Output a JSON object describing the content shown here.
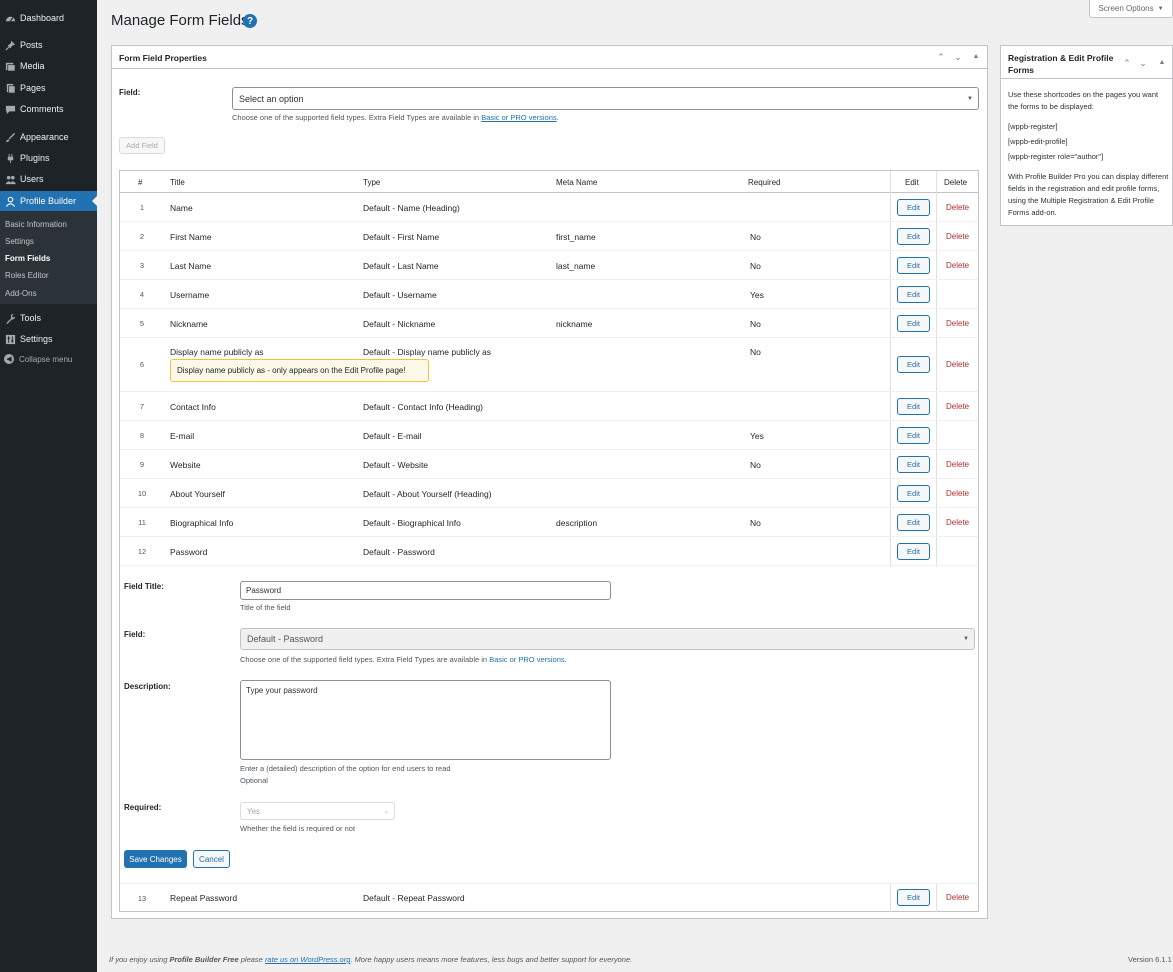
{
  "sidebar": {
    "items": [
      {
        "label": "Dashboard",
        "icon": "dashboard-icon"
      },
      {
        "label": "Posts",
        "icon": "pin-icon"
      },
      {
        "label": "Media",
        "icon": "media-icon"
      },
      {
        "label": "Pages",
        "icon": "page-icon"
      },
      {
        "label": "Comments",
        "icon": "comment-icon"
      },
      {
        "label": "Appearance",
        "icon": "brush-icon"
      },
      {
        "label": "Plugins",
        "icon": "plug-icon"
      },
      {
        "label": "Users",
        "icon": "users-icon"
      },
      {
        "label": "Profile Builder",
        "icon": "person-icon"
      },
      {
        "label": "Tools",
        "icon": "wrench-icon"
      },
      {
        "label": "Settings",
        "icon": "sliders-icon"
      }
    ],
    "submenu": [
      "Basic Information",
      "Settings",
      "Form Fields",
      "Roles Editor",
      "Add-Ons"
    ],
    "collapse": "Collapse menu"
  },
  "header": {
    "title": "Manage Form Fields",
    "help": "?",
    "screen_options": "Screen Options"
  },
  "main_panel": {
    "title": "Form Field Properties",
    "field_label": "Field:",
    "field_select": "Select an option",
    "field_help_prefix": "Choose one of the supported field types. Extra Field Types are available in ",
    "field_help_link": "Basic or PRO versions",
    "field_help_suffix": ".",
    "add_field": "Add Field"
  },
  "table": {
    "headers": {
      "num": "#",
      "title": "Title",
      "type": "Type",
      "meta": "Meta Name",
      "required": "Required",
      "edit": "Edit",
      "delete": "Delete"
    },
    "edit_label": "Edit",
    "delete_label": "Delete",
    "rows": [
      {
        "num": "1",
        "title": "Name",
        "type": "Default - Name (Heading)",
        "meta": "",
        "required": "",
        "delete": true
      },
      {
        "num": "2",
        "title": "First Name",
        "type": "Default - First Name",
        "meta": "first_name",
        "required": "No",
        "delete": true
      },
      {
        "num": "3",
        "title": "Last Name",
        "type": "Default - Last Name",
        "meta": "last_name",
        "required": "No",
        "delete": true
      },
      {
        "num": "4",
        "title": "Username",
        "type": "Default - Username",
        "meta": "",
        "required": "Yes",
        "delete": false
      },
      {
        "num": "5",
        "title": "Nickname",
        "type": "Default - Nickname",
        "meta": "nickname",
        "required": "No",
        "delete": true
      },
      {
        "num": "6",
        "title": "Display name publicly as",
        "type": "Default - Display name publicly as",
        "meta": "",
        "required": "No",
        "delete": true,
        "notice": "Display name publicly as - only appears on the Edit Profile page!"
      },
      {
        "num": "7",
        "title": "Contact Info",
        "type": "Default - Contact Info (Heading)",
        "meta": "",
        "required": "",
        "delete": true
      },
      {
        "num": "8",
        "title": "E-mail",
        "type": "Default - E-mail",
        "meta": "",
        "required": "Yes",
        "delete": false
      },
      {
        "num": "9",
        "title": "Website",
        "type": "Default - Website",
        "meta": "",
        "required": "No",
        "delete": true
      },
      {
        "num": "10",
        "title": "About Yourself",
        "type": "Default - About Yourself (Heading)",
        "meta": "",
        "required": "",
        "delete": true
      },
      {
        "num": "11",
        "title": "Biographical Info",
        "type": "Default - Biographical Info",
        "meta": "description",
        "required": "No",
        "delete": true
      },
      {
        "num": "12",
        "title": "Password",
        "type": "Default - Password",
        "meta": "",
        "required": "",
        "delete": false
      }
    ],
    "last_row": {
      "num": "13",
      "title": "Repeat Password",
      "type": "Default - Repeat Password",
      "meta": "",
      "required": "",
      "delete": true
    }
  },
  "edit_form": {
    "field_title_label": "Field Title:",
    "field_title_value": "Password",
    "field_title_help": "Title of the field",
    "field_label": "Field:",
    "field_value": "Default - Password",
    "field_help_prefix": "Choose one of the supported field types. Extra Field Types are available in ",
    "field_help_link": "Basic or PRO versions",
    "field_help_suffix": ".",
    "description_label": "Description:",
    "description_value": "Type your password",
    "description_help": "Enter a (detailed) description of the option for end users to read",
    "description_help2": "Optional",
    "required_label": "Required:",
    "required_value": "Yes",
    "required_help": "Whether the field is required or not",
    "save": "Save Changes",
    "cancel": "Cancel"
  },
  "side_panel": {
    "title": "Registration & Edit Profile Forms",
    "intro": "Use these shortcodes on the pages you want the forms to be displayed:",
    "shortcodes": [
      "[wppb-register]",
      "[wppb-edit-profile]",
      "[wppb-register role=\"author\"]"
    ],
    "pro_text": "With Profile Builder Pro you can display different fields in the registration and edit profile forms, using the Multiple Registration & Edit Profile Forms add-on."
  },
  "footer": {
    "prefix": "If you enjoy using ",
    "brand": "Profile Builder Free",
    "middle": " please ",
    "link": "rate us on WordPress.org",
    "suffix": ". More happy users means more features, less bugs and better support for everyone.",
    "version": "Version 6.1.1"
  }
}
